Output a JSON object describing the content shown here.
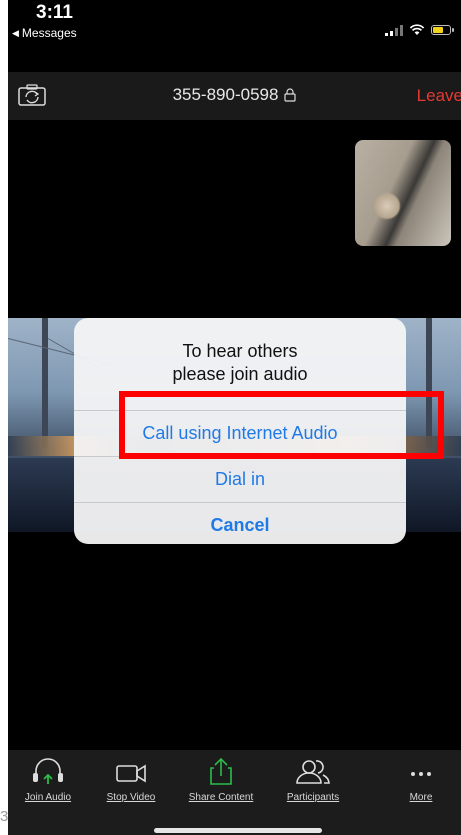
{
  "status_bar": {
    "time": "3:11",
    "back_label": "Messages"
  },
  "meeting_header": {
    "meeting_id": "355-890-0598",
    "leave_label": "Leave"
  },
  "dialog": {
    "title_line1": "To hear others",
    "title_line2": "please join audio",
    "options": [
      {
        "label": "Call using Internet Audio",
        "highlighted": true
      },
      {
        "label": "Dial in",
        "highlighted": false
      },
      {
        "label": "Cancel",
        "highlighted": false
      }
    ]
  },
  "toolbar": {
    "items": [
      {
        "label": "Join Audio",
        "icon": "headphones-icon"
      },
      {
        "label": "Stop Video",
        "icon": "video-camera-icon"
      },
      {
        "label": "Share Content",
        "icon": "share-upload-icon"
      },
      {
        "label": "Participants",
        "icon": "participants-icon"
      },
      {
        "label": "More",
        "icon": "more-dots-icon"
      }
    ]
  },
  "page_number": "3",
  "colors": {
    "accent_blue": "#1f7ae8",
    "leave_red": "#e53935",
    "highlight_red": "#ff0000",
    "share_green": "#2bbd4b"
  }
}
